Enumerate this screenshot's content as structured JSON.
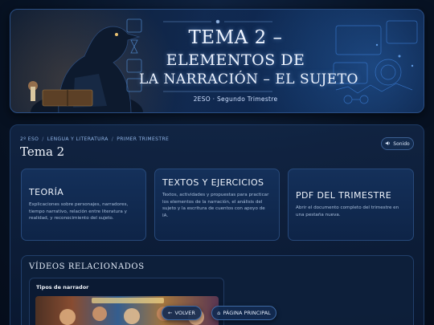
{
  "hero": {
    "title_line1": "TEMA 2 –",
    "title_line2": "ELEMENTOS DE",
    "title_line3": "LA NARRACIÓN – EL SUJETO",
    "subtitle": "2ESO · Segundo Trimestre"
  },
  "breadcrumb": {
    "course": "2º ESO",
    "subject": "LENGUA Y LITERATURA",
    "term": "PRIMER TRIMESTRE",
    "separator": "/"
  },
  "page_title": "Tema 2",
  "sound_button": {
    "icon": "speaker-icon",
    "label": "Sonido"
  },
  "cards": [
    {
      "title": "TEORÍA",
      "description": "Explicaciones sobre personajes, narradores, tiempo narrativo, relación entre literatura y realidad, y reconocimiento del sujeto."
    },
    {
      "title": "TEXTOS Y EJERCICIOS",
      "description": "Textos, actividades y propuestas para practicar los elementos de la narración, el análisis del sujeto y la escritura de cuentos con apoyo de IA."
    },
    {
      "title": "PDF DEL TRIMESTRE",
      "description": "Abrir el documento completo del trimestre en una pestaña nueva."
    }
  ],
  "videos": {
    "section_title": "VÍDEOS RELACIONADOS",
    "items": [
      {
        "title": "Tipos de narrador"
      }
    ]
  },
  "nav": {
    "back_icon": "arrow-left-icon",
    "back_label": "VOLVER",
    "home_icon": "home-icon",
    "home_label": "PÁGINA PRINCIPAL"
  },
  "colors": {
    "background": "#081426",
    "panel": "#122646",
    "card": "#14305a",
    "accent": "#3e6aa6",
    "text": "#eef3fb"
  }
}
